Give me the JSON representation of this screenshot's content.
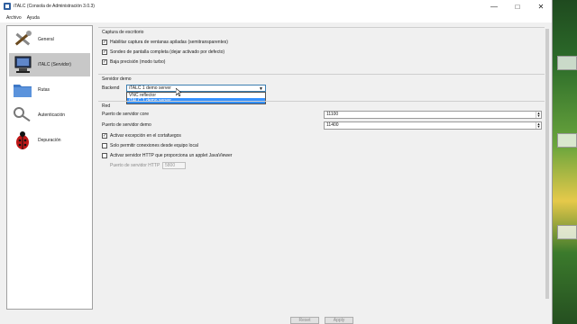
{
  "window": {
    "title": "iTALC (Consola de Administración 3.0.3)",
    "controls": {
      "minimize": "—",
      "maximize": "□",
      "close": "✕"
    }
  },
  "menu": [
    "Archivo",
    "Ayuda"
  ],
  "sidebar": {
    "items": [
      {
        "label": "General",
        "icon": "tools-icon",
        "active": false
      },
      {
        "label": "iTALC (Servidor)",
        "icon": "computer-icon",
        "active": true
      },
      {
        "label": "Rutas",
        "icon": "folder-icon",
        "active": false
      },
      {
        "label": "Autenticación",
        "icon": "key-icon",
        "active": false
      },
      {
        "label": "Depuración",
        "icon": "ladybug-icon",
        "active": false
      }
    ]
  },
  "capture": {
    "title": "Captura de escritorio",
    "options": [
      {
        "label": "Habilitar captura de ventanas apiladas (semitransparentes)",
        "checked": true
      },
      {
        "label": "Sondeo de pantalla completa (dejar activado por defecto)",
        "checked": true
      },
      {
        "label": "Baja precisión (modo turbo)",
        "checked": true
      }
    ]
  },
  "demo_server": {
    "title": "Servidor demo",
    "backend_label": "Backend",
    "backend_value": "iTALC 1 demo server",
    "options": [
      "VNC reflector",
      "iTALC 1 demo server"
    ],
    "selected_index": 1
  },
  "network": {
    "title": "Red",
    "core_port_label": "Puerto de servidor core",
    "core_port_value": "11100",
    "demo_port_label": "Puerto de servidor demo",
    "demo_port_value": "11400",
    "options": [
      {
        "label": "Activar excepción en el cortafuegos",
        "checked": true
      },
      {
        "label": "Solo permitir conexiones desde equipo local",
        "checked": false
      },
      {
        "label": "Activar servidor HTTP que proporciona un applet JavaViewer",
        "checked": false
      }
    ],
    "http_port_label": "Puerto de servidor HTTP",
    "http_port_value": "5800"
  },
  "footer": {
    "reset": "Reset",
    "apply": "Apply"
  }
}
